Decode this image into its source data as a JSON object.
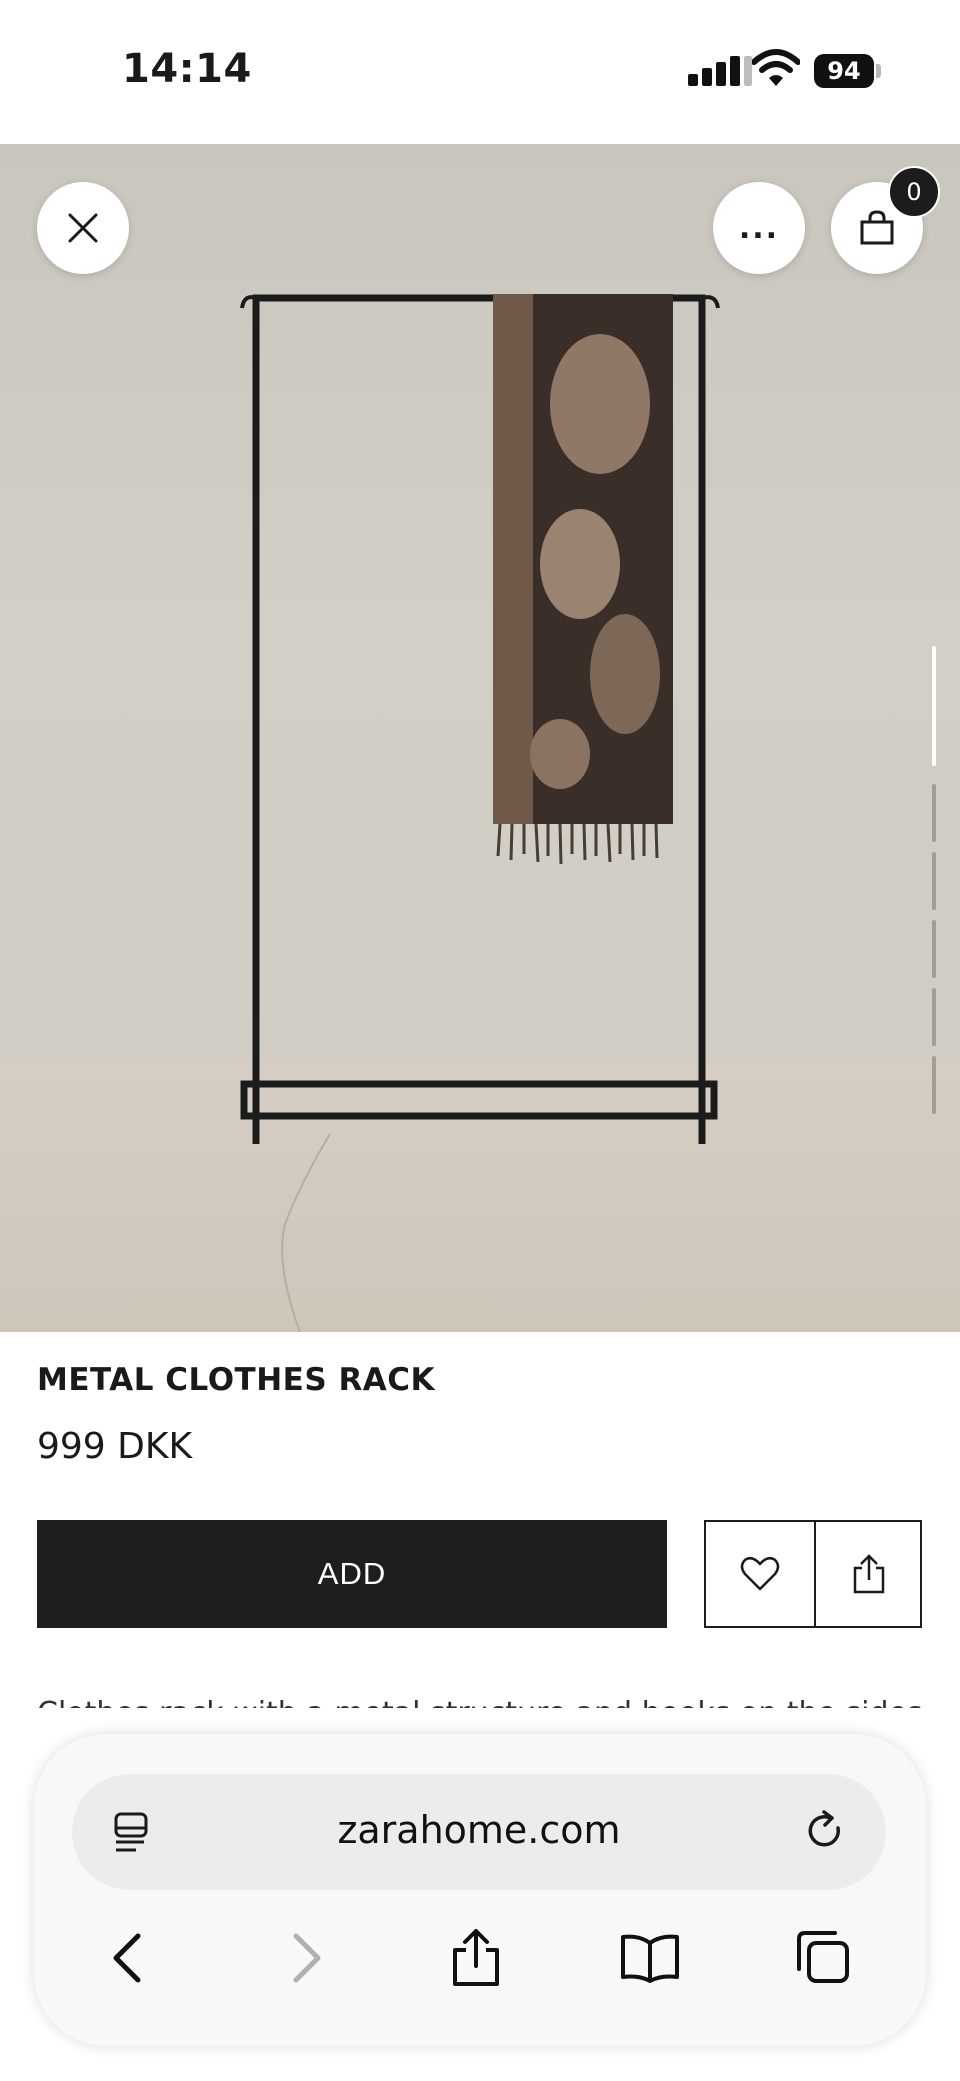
{
  "status_bar": {
    "time": "14:14",
    "battery": "94"
  },
  "product": {
    "name": "METAL CLOTHES RACK",
    "price": "999 DKK",
    "add_label": "ADD",
    "cart_count": "0",
    "more_label": "...",
    "description_snippet": "Clothes rack with a metal structure and hooks on the sides"
  },
  "browser": {
    "url": "zarahome.com"
  },
  "icons": {
    "close": "close-icon",
    "more": "more-icon",
    "bag": "bag-icon",
    "heart": "heart-icon",
    "share": "share-icon",
    "reader": "reader-icon",
    "reload": "reload-icon",
    "back": "chevron-left-icon",
    "forward": "chevron-right-icon",
    "browser_share": "share-icon",
    "bookmarks": "book-icon",
    "tabs": "tabs-icon"
  },
  "colors": {
    "primary": "#1e1e1e",
    "background": "#ffffff",
    "toolbar": "#f8f8f8",
    "disabled": "#b0b0b0"
  }
}
